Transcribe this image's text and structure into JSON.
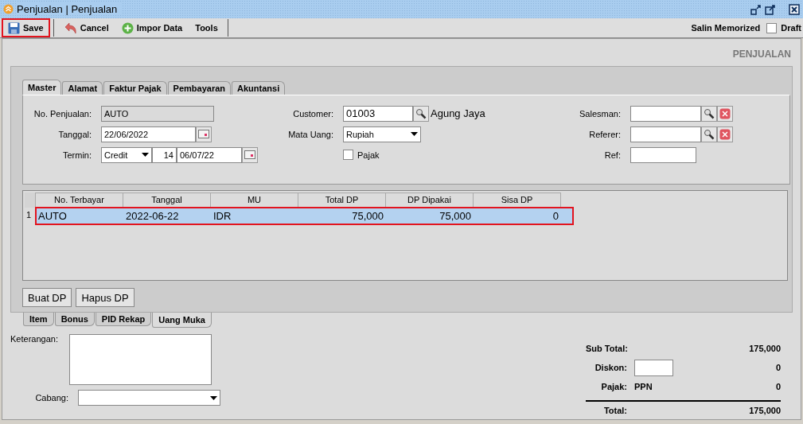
{
  "window": {
    "title": "Penjualan | Penjualan"
  },
  "toolbar": {
    "buttons": [
      {
        "label": "Save",
        "kind": "save",
        "highlighted": true
      },
      {
        "label": "Cancel",
        "kind": "undo",
        "highlighted": false
      },
      {
        "label": "Impor Data",
        "kind": "plus",
        "highlighted": false
      },
      {
        "label": "Tools",
        "kind": "text",
        "highlighted": false
      }
    ],
    "memorized": "Salin Memorized",
    "draft": {
      "label": "Draft",
      "checked": false
    }
  },
  "form_title": "PENJUALAN",
  "tabs": [
    {
      "label": "Master",
      "selected": true
    },
    {
      "label": "Alamat",
      "selected": false
    },
    {
      "label": "Faktur Pajak",
      "selected": false
    },
    {
      "label": "Pembayaran",
      "selected": false
    },
    {
      "label": "Akuntansi",
      "selected": false
    }
  ],
  "master": {
    "no_penjualan": {
      "label": "No. Penjualan:",
      "value": "AUTO"
    },
    "tanggal": {
      "label": "Tanggal:",
      "value": "22/06/2022"
    },
    "termin": {
      "label": "Termin:",
      "type": "Credit",
      "days": "14",
      "date": "06/07/22"
    },
    "customer": {
      "label": "Customer:",
      "code": "01003",
      "name": "Agung Jaya"
    },
    "mata_uang": {
      "label": "Mata Uang:",
      "value": "Rupiah"
    },
    "pajak": {
      "label": "Pajak",
      "checked": false
    },
    "salesman": {
      "label": "Salesman:"
    },
    "referer": {
      "label": "Referer:"
    },
    "ref": {
      "label": "Ref:"
    }
  },
  "dp_table": {
    "columns": [
      "No. Terbayar",
      "Tanggal",
      "MU",
      "Total DP",
      "DP Dipakai",
      "Sisa DP"
    ],
    "rows": [
      {
        "number": "1",
        "cells": [
          "AUTO",
          "2022-06-22",
          "IDR",
          "75,000",
          "75,000",
          "0"
        ],
        "selected": true,
        "highlighted": true
      }
    ]
  },
  "dp_buttons": [
    "Buat DP",
    "Hapus DP"
  ],
  "bottom_tabs": [
    {
      "label": "Item",
      "selected": false
    },
    {
      "label": "Bonus",
      "selected": false
    },
    {
      "label": "PID Rekap",
      "selected": false
    },
    {
      "label": "Uang Muka",
      "selected": true
    }
  ],
  "notes": {
    "label": "Keterangan:"
  },
  "branch": {
    "label": "Cabang:"
  },
  "totals": [
    {
      "kind": "plain",
      "label": "Sub Total:",
      "value": "175,000"
    },
    {
      "kind": "input",
      "label": "Diskon:",
      "value": "0"
    },
    {
      "kind": "tax",
      "label": "Pajak:",
      "tax": "PPN",
      "value": "0"
    },
    {
      "kind": "total",
      "label": "Total:",
      "value": "175,000"
    }
  ]
}
